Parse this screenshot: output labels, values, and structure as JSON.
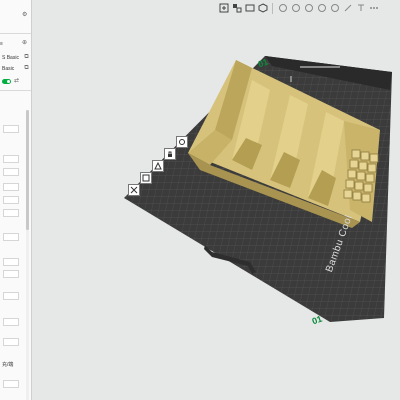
{
  "left_panel": {
    "preset_top": "≡",
    "filament_1": "S Basic",
    "filament_2": "Basic",
    "bottom_label": "充/端"
  },
  "viewport": {
    "plate_number": "01",
    "plate_number_alt": "01",
    "plate_brand": "Bambu Cool"
  },
  "colors": {
    "accent": "#00ae42",
    "plate": "#3f3f3f",
    "model": "#c9b46a",
    "background": "#e6e7e7"
  },
  "toolbar": {
    "icons": [
      "add-icon",
      "arrange-icon",
      "orient-icon",
      "cube-icon",
      "layers-icon",
      "split-icon",
      "cut-icon",
      "support-icon",
      "seam-icon",
      "measure-icon",
      "text-icon",
      "more-icon"
    ]
  }
}
